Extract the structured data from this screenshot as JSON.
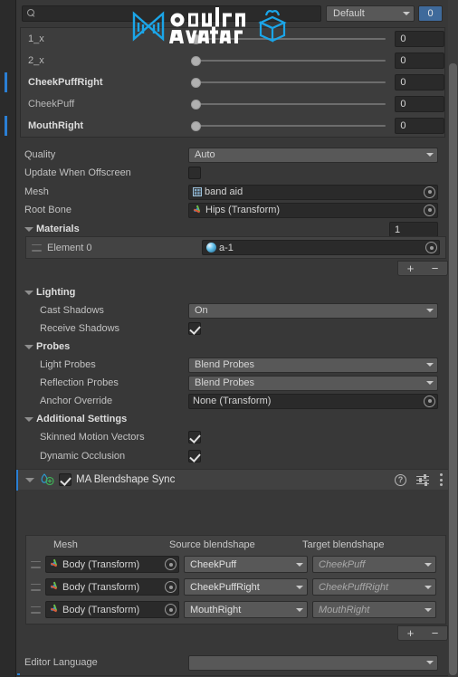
{
  "window": {
    "background": "#383838",
    "accent": "#2a7fd4"
  },
  "search": {
    "placeholder": "",
    "value": "",
    "icon": "search-icon",
    "preset_dropdown": "Default",
    "badge_count": "0"
  },
  "blendshape_sliders": {
    "rows": [
      {
        "label": "1_x",
        "value": "0",
        "bold": false,
        "marked": false
      },
      {
        "label": "2_x",
        "value": "0",
        "bold": false,
        "marked": false
      },
      {
        "label": "CheekPuffRight",
        "value": "0",
        "bold": true,
        "marked": true
      },
      {
        "label": "CheekPuff",
        "value": "0",
        "bold": false,
        "marked": false
      },
      {
        "label": "MouthRight",
        "value": "0",
        "bold": true,
        "marked": true
      }
    ]
  },
  "renderer": {
    "quality_label": "Quality",
    "quality_value": "Auto",
    "update_offscreen_label": "Update When Offscreen",
    "update_offscreen_checked": false,
    "mesh_label": "Mesh",
    "mesh_value": "band aid",
    "mesh_icon": "mesh-icon",
    "root_bone_label": "Root Bone",
    "root_bone_value": "Hips (Transform)",
    "root_bone_icon": "transform-icon"
  },
  "materials": {
    "header": "Materials",
    "count": "1",
    "elements": [
      {
        "label": "Element 0",
        "value": "a-1",
        "icon": "material-icon"
      }
    ],
    "add_label": "+",
    "remove_label": "−"
  },
  "lighting": {
    "header": "Lighting",
    "cast_shadows_label": "Cast Shadows",
    "cast_shadows_value": "On",
    "receive_shadows_label": "Receive Shadows",
    "receive_shadows_checked": true
  },
  "probes": {
    "header": "Probes",
    "light_probes_label": "Light Probes",
    "light_probes_value": "Blend Probes",
    "reflection_probes_label": "Reflection Probes",
    "reflection_probes_value": "Blend Probes",
    "anchor_override_label": "Anchor Override",
    "anchor_override_value": "None (Transform)"
  },
  "additional_settings": {
    "header": "Additional Settings",
    "skinned_motion_vectors_label": "Skinned Motion Vectors",
    "skinned_motion_vectors_checked": true,
    "dynamic_occlusion_label": "Dynamic Occlusion",
    "dynamic_occlusion_checked": true
  },
  "ma_component": {
    "title": "MA Blendshape Sync",
    "enabled": true,
    "icon": "modular-avatar-component-icon",
    "help_icon": "help-icon",
    "preset_icon": "preset-icon",
    "menu_icon": "kebab-menu-icon",
    "logo_alt": "Modular Avatar",
    "logo_color": "#1ba5e8",
    "table": {
      "columns": [
        "Mesh",
        "Source blendshape",
        "Target blendshape"
      ],
      "rows": [
        {
          "mesh": "Body (Transform)",
          "source": "CheekPuff",
          "target_placeholder": "CheekPuff"
        },
        {
          "mesh": "Body (Transform)",
          "source": "CheekPuffRight",
          "target_placeholder": "CheekPuffRight"
        },
        {
          "mesh": "Body (Transform)",
          "source": "MouthRight",
          "target_placeholder": "MouthRight"
        }
      ],
      "add_label": "+",
      "remove_label": "−"
    },
    "editor_language_label": "Editor Language",
    "editor_language_value": ""
  }
}
